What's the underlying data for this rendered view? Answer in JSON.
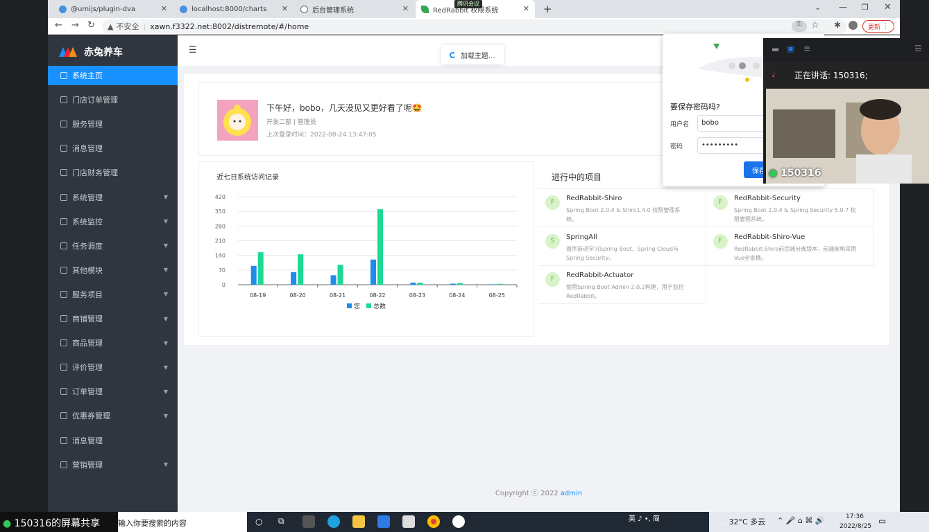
{
  "browser": {
    "tabs": [
      {
        "label": "@umijs/plugin-dva",
        "color": "#4a90e2"
      },
      {
        "label": "localhost:8000/charts",
        "color": "#4a90e2"
      },
      {
        "label": "后台管理系统",
        "color": "#666666"
      },
      {
        "label": "RedRabbit 权限系统",
        "color": "#34a853"
      }
    ],
    "security_label": "不安全",
    "url": "xawn.f3322.net:8002/distremote/#/home",
    "update_label": "更新",
    "tencent_meeting_tag": "腾讯会议"
  },
  "app": {
    "logo_text": "赤兔养车",
    "loading_text": "加载主题...",
    "menu": [
      {
        "label": "系统主页",
        "active": true,
        "expandable": false
      },
      {
        "label": "门店订单管理",
        "expandable": false
      },
      {
        "label": "服务管理",
        "expandable": false
      },
      {
        "label": "消息管理",
        "expandable": false
      },
      {
        "label": "门店财务管理",
        "expandable": false
      },
      {
        "label": "系统管理",
        "expandable": true
      },
      {
        "label": "系统监控",
        "expandable": true
      },
      {
        "label": "任务调度",
        "expandable": true
      },
      {
        "label": "其他模块",
        "expandable": true
      },
      {
        "label": "服务项目",
        "expandable": true
      },
      {
        "label": "商铺管理",
        "expandable": true
      },
      {
        "label": "商品管理",
        "expandable": true
      },
      {
        "label": "评价管理",
        "expandable": true
      },
      {
        "label": "订单管理",
        "expandable": true
      },
      {
        "label": "优惠券管理",
        "expandable": true
      },
      {
        "label": "消息管理",
        "expandable": false
      },
      {
        "label": "营销管理",
        "expandable": true
      }
    ],
    "welcome": {
      "greeting": "下午好，bobo，几天没见又更好看了呢🤩",
      "dept": "开发二部 | 管理员",
      "last_login": "上次登录时间：2022-08-24 13:47:05"
    },
    "chart_card_title": "近七日系统访问记录",
    "projects_title": "进行中的项目",
    "projects": [
      {
        "initial": "F",
        "name": "RedRabbit-Shiro",
        "desc": "Spring Boot 2.0.4 & Shiro1.4.0 权限管理系统。"
      },
      {
        "initial": "F",
        "name": "RedRabbit-Security",
        "desc": "Spring Boot 2.0.4 & Spring Security 5.0.7 权限管理系统。"
      },
      {
        "initial": "S",
        "name": "SpringAll",
        "desc": "循序渐进学习Spring Boot、Spring Cloud与Spring Security。"
      },
      {
        "initial": "F",
        "name": "RedRabbit-Shiro-Vue",
        "desc": "RedRabbit-Shiro前后端分离版本，前端架构采用Vue全家桶。"
      },
      {
        "initial": "F",
        "name": "RedRabbit-Actuator",
        "desc": "使用Spring Boot Admin 2.0.2构建，用于监控RedRabbit。"
      }
    ],
    "copyright_prefix": "Copyright ⓒ 2022 ",
    "copyright_link": "admin"
  },
  "chart_data": {
    "type": "bar",
    "categories": [
      "08-19",
      "08-20",
      "08-21",
      "08-22",
      "08-23",
      "08-24",
      "08-25"
    ],
    "series": [
      {
        "name": "您",
        "values": [
          90,
          60,
          45,
          120,
          10,
          5,
          2
        ],
        "color": "#1f8cec"
      },
      {
        "name": "总数",
        "values": [
          155,
          145,
          95,
          360,
          10,
          8,
          4
        ],
        "color": "#1ed994"
      }
    ],
    "yticks": [
      0,
      70,
      140,
      210,
      280,
      350,
      420
    ],
    "ylim": [
      0,
      420
    ],
    "grid": true,
    "legend": "bottom"
  },
  "password_popup": {
    "title": "要保存密码吗?",
    "username_label": "用户名",
    "username_value": "bobo",
    "password_label": "密码",
    "password_value": "•••••••••",
    "save_label": "保存"
  },
  "meeting": {
    "speaking_text": "正在讲话: 150316;",
    "video_name": "150316"
  },
  "taskbar": {
    "share_label": "150316的屏幕共享",
    "search_placeholder": "输入你要搜索的内容",
    "ime": "英 ♪ •, 简",
    "weather": "32°C  多云",
    "time": "17:36",
    "date": "2022/8/25"
  }
}
